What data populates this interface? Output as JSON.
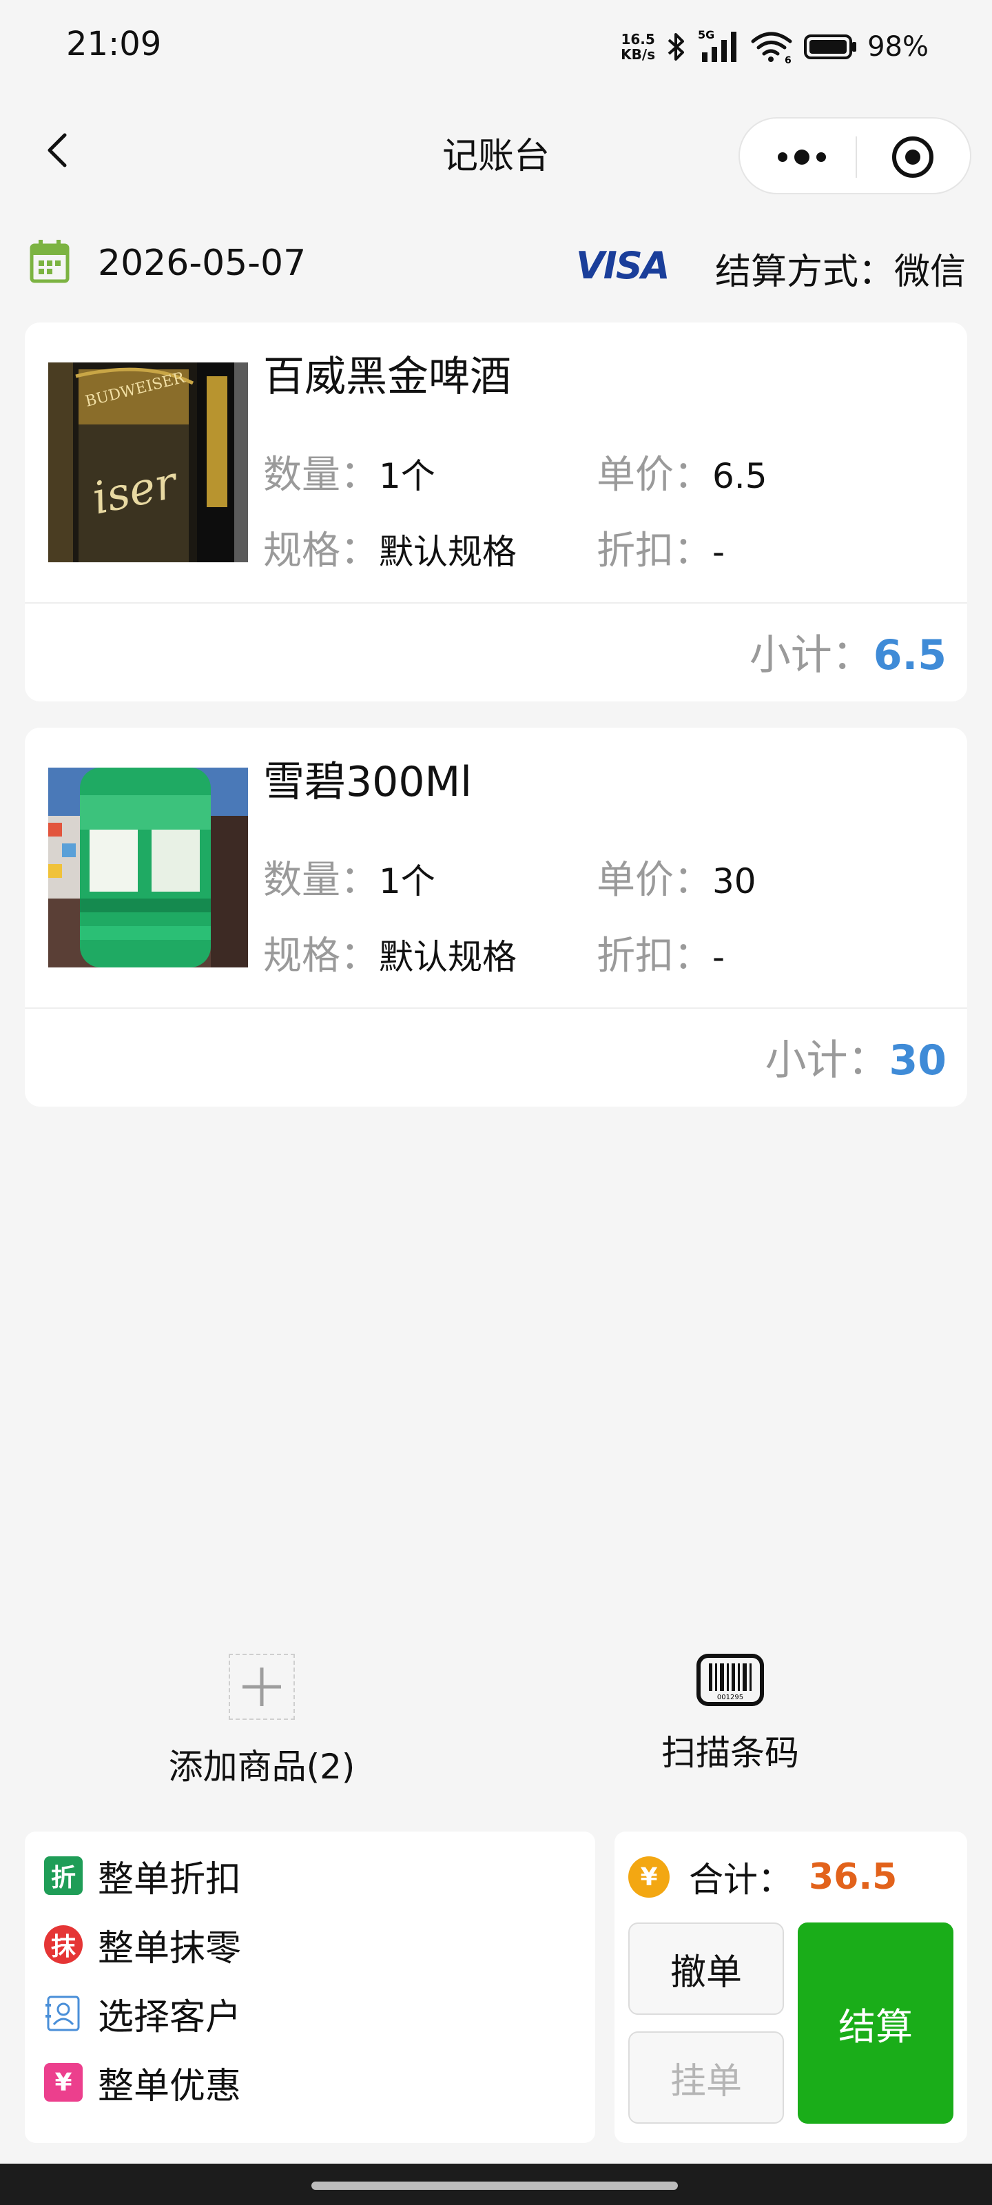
{
  "status_bar": {
    "time": "21:09",
    "net_speed_value": "16.5",
    "net_speed_unit": "KB/s",
    "network": "5G",
    "wifi_badge": "6",
    "battery": "98%"
  },
  "nav": {
    "title": "记账台"
  },
  "info": {
    "date": "2026-05-07",
    "visa_text": "VISA",
    "payment_method": "结算方式：微信"
  },
  "items": [
    {
      "name": "百威黑金啤酒",
      "qty_label": "数量：",
      "qty": "1个",
      "price_label": "单价：",
      "price": "6.5",
      "spec_label": "规格：",
      "spec": "默认规格",
      "discount_label": "折扣：",
      "discount": "-",
      "subtotal_label": "小计：",
      "subtotal": "6.5"
    },
    {
      "name": "雪碧300Ml",
      "qty_label": "数量：",
      "qty": "1个",
      "price_label": "单价：",
      "price": "30",
      "spec_label": "规格：",
      "spec": "默认规格",
      "discount_label": "折扣：",
      "discount": "-",
      "subtotal_label": "小计：",
      "subtotal": "30"
    }
  ],
  "actions": {
    "add_goods": "添加商品(2)",
    "scan_code": "扫描条码",
    "barcode_number": "001295"
  },
  "options": [
    {
      "icon_text": "折",
      "label": "整单折扣",
      "icon": "discount-icon",
      "color": "#1f9d57"
    },
    {
      "icon_text": "抹",
      "label": "整单抹零",
      "icon": "round-off-icon",
      "color": "#e53535"
    },
    {
      "icon_text": "",
      "label": "选择客户",
      "icon": "customer-icon",
      "color": "#4a8fd8"
    },
    {
      "icon_text": "¥",
      "label": "整单优惠",
      "icon": "coupon-icon",
      "color": "#ec3f8d"
    }
  ],
  "summary": {
    "coin_symbol": "¥",
    "total_label": "合计：",
    "total": "36.5",
    "cancel": "撤单",
    "hold": "挂单",
    "settle": "结算"
  }
}
